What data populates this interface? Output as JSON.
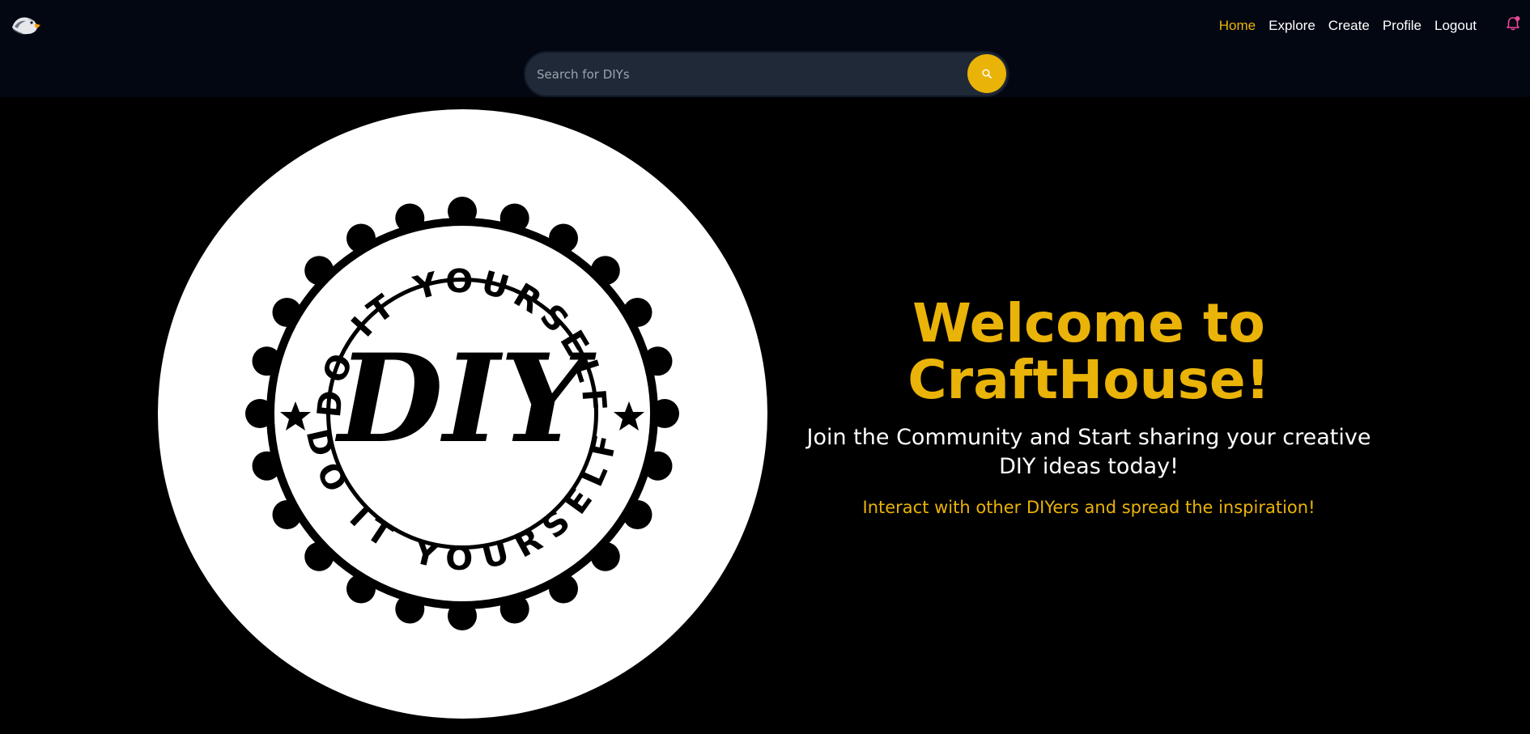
{
  "app": {
    "logo_icon": "eagle-logo-icon",
    "accent_color": "#eab308",
    "nav_background": "#030712"
  },
  "nav": {
    "items": [
      {
        "label": "Home",
        "active": true
      },
      {
        "label": "Explore",
        "active": false
      },
      {
        "label": "Create",
        "active": false
      },
      {
        "label": "Profile",
        "active": false
      },
      {
        "label": "Logout",
        "active": false
      }
    ],
    "notification_icon": "bell-icon",
    "notification_dot_color": "#ec4899"
  },
  "search": {
    "placeholder": "Search for DIYs",
    "value": "",
    "button_icon": "search-icon"
  },
  "hero": {
    "badge": {
      "center_text": "DIY",
      "ring_text_top": "DO IT YOURSELF",
      "ring_text_bottom": "DO IT YOURSELF"
    },
    "title": "Welcome to CraftHouse!",
    "subtitle": "Join the Community and Start sharing your creative DIY ideas today!",
    "tagline": "Interact with other DIYers and spread the inspiration!"
  }
}
